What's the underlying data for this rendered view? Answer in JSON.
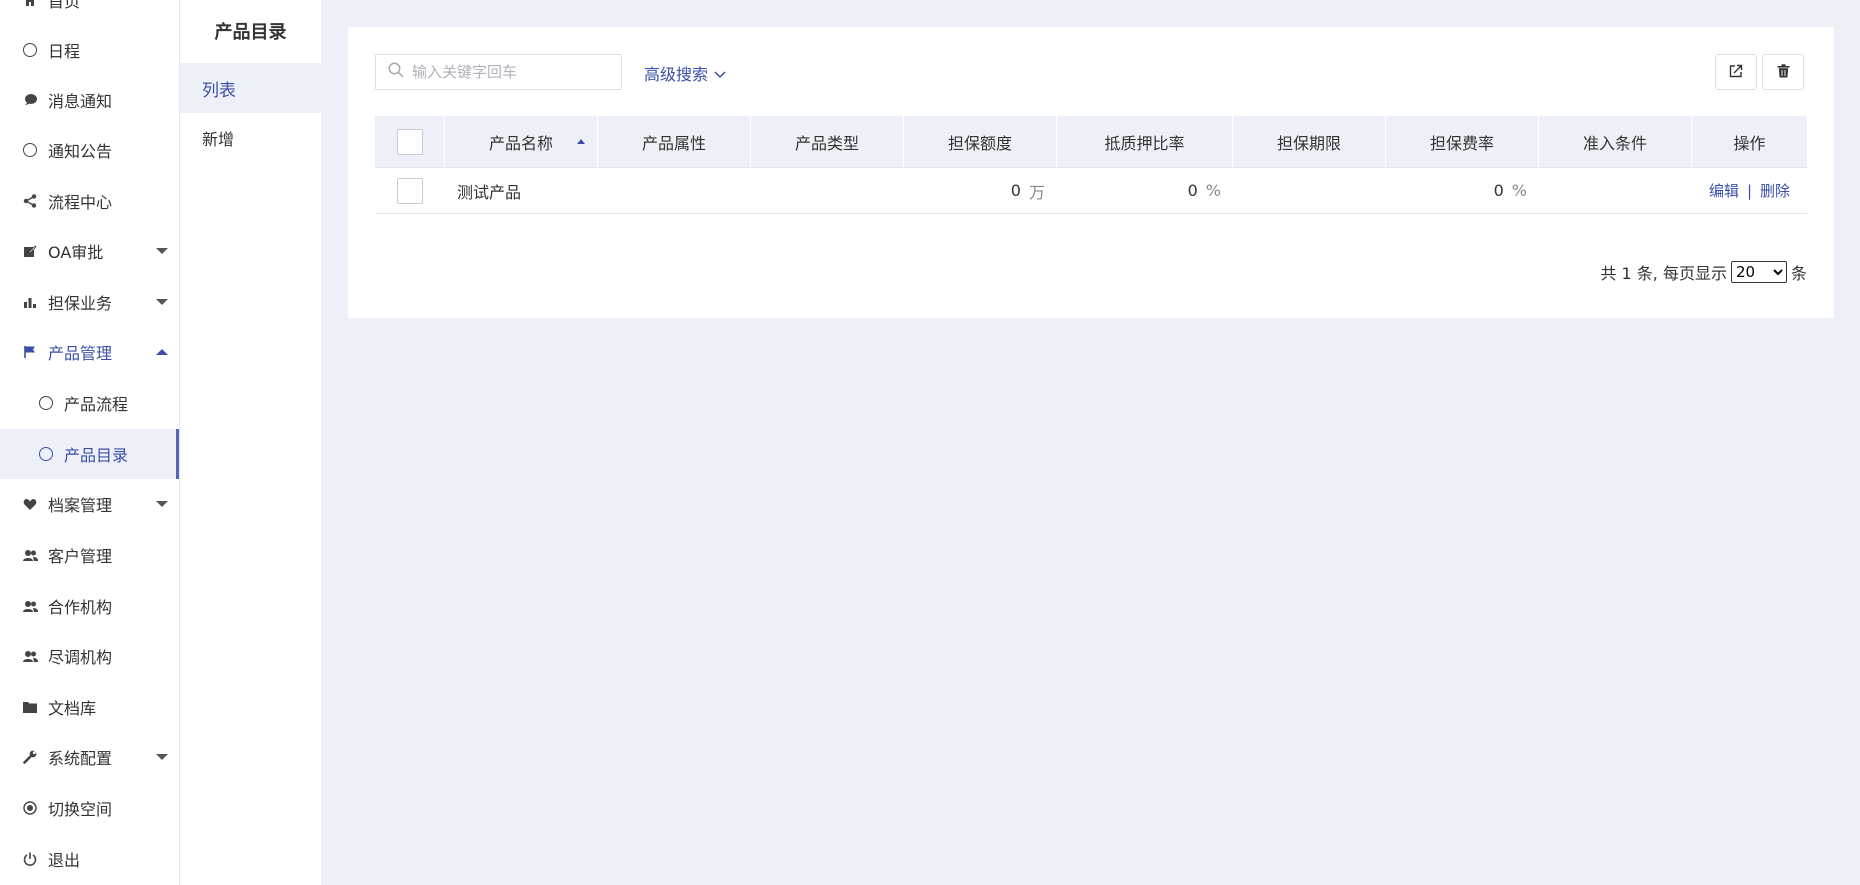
{
  "nav": {
    "items": [
      {
        "label": "首页"
      },
      {
        "label": "日程"
      },
      {
        "label": "消息通知"
      },
      {
        "label": "通知公告"
      },
      {
        "label": "流程中心"
      },
      {
        "label": "OA审批"
      },
      {
        "label": "担保业务"
      },
      {
        "label": "产品管理"
      },
      {
        "label": "产品流程"
      },
      {
        "label": "产品目录"
      },
      {
        "label": "档案管理"
      },
      {
        "label": "客户管理"
      },
      {
        "label": "合作机构"
      },
      {
        "label": "尽调机构"
      },
      {
        "label": "文档库"
      },
      {
        "label": "系统配置"
      },
      {
        "label": "切换空间"
      },
      {
        "label": "退出"
      }
    ]
  },
  "submenu": {
    "title": "产品目录",
    "items": [
      {
        "label": "列表"
      },
      {
        "label": "新增"
      }
    ]
  },
  "toolbar": {
    "search_placeholder": "输入关键字回车",
    "search_value": "",
    "advanced_search": "高级搜索"
  },
  "table": {
    "columns": [
      "产品名称",
      "产品属性",
      "产品类型",
      "担保额度",
      "抵质押比率",
      "担保期限",
      "担保费率",
      "准入条件",
      "操作"
    ],
    "rows": [
      {
        "name": "测试产品",
        "attr": "",
        "type": "",
        "amount": "0",
        "amount_unit": "万",
        "ratio": "0",
        "ratio_unit": "%",
        "term": "",
        "fee": "0",
        "fee_unit": "%",
        "condition": "",
        "edit": "编辑",
        "sep": "|",
        "delete": "删除"
      }
    ]
  },
  "pager": {
    "prefix": "共 1 条, 每页显示",
    "page_size": "20",
    "suffix": "条"
  },
  "colors": {
    "accent": "#3b4fa8",
    "bg": "#eef0f8"
  }
}
